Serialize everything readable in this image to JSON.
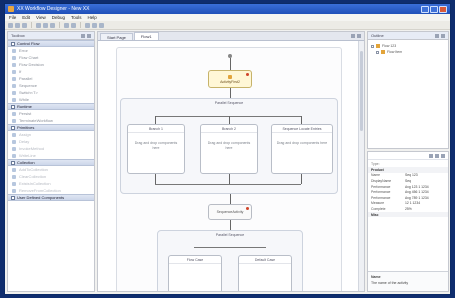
{
  "window": {
    "title": "XX Workflow Designer - New XX"
  },
  "menu": [
    "File",
    "Edit",
    "View",
    "Debug",
    "Tools",
    "Help"
  ],
  "palette": {
    "title": "Toolbox",
    "sections": [
      {
        "label": "Control Flow",
        "items": [
          "Error",
          "Flow Chart",
          "Flow Decision",
          "If",
          "Parallel",
          "Sequence",
          "Switch<T>",
          "While"
        ]
      },
      {
        "label": "Runtime",
        "items": [
          "Persist",
          "TerminateWorkflow"
        ]
      },
      {
        "label": "Primitives",
        "items": [
          "Assign",
          "Delay",
          "InvokeMethod",
          "WriteLine"
        ]
      },
      {
        "label": "Collection",
        "items": [
          "AddToCollection",
          "ClearCollection",
          "ExistsInCollection",
          "RemoveFromCollection"
        ]
      },
      {
        "label": "User Defined Components",
        "items": []
      }
    ]
  },
  "editor": {
    "tabs": [
      "Start Page",
      "Flow1"
    ],
    "active_tab": "Flow1",
    "flow": {
      "top_activity": "ActivityFirst2",
      "sequence_label": "Parallel Sequence",
      "branches": [
        {
          "title": "Branch 1",
          "body": "Drag and drop components here"
        },
        {
          "title": "Branch 2",
          "body": "Drag and drop components here"
        },
        {
          "title": "Sequence Locate Entries",
          "body": "Drag and drop components here"
        }
      ],
      "middle_activity": "SequenceActivity",
      "lower_sequence_label": "Parallel Sequence",
      "lower_branches": [
        "Flow Case",
        "Default Case"
      ]
    }
  },
  "outline": {
    "title": "Outline",
    "items": [
      {
        "label": "Flow 123",
        "level": 0
      },
      {
        "label": "Flow Item",
        "level": 1
      }
    ]
  },
  "properties": {
    "title": "Properties",
    "filter": "Type:",
    "categories": [
      {
        "label": "Product",
        "rows": [
          {
            "key": "Name",
            "value": "Seq 123"
          },
          {
            "key": "DisplayName",
            "value": "Seq"
          },
          {
            "key": "Performance",
            "value": "Avg 123 1 1234"
          },
          {
            "key": "Performance",
            "value": "Avg 456 1 1234"
          },
          {
            "key": "Performance",
            "value": "Avg 789 1 1234"
          },
          {
            "key": "Measure",
            "value": "12 1 1234"
          },
          {
            "key": "Complete",
            "value": "25%"
          }
        ]
      },
      {
        "label": "Misc",
        "rows": []
      }
    ],
    "desc_title": "Name",
    "desc_text": "The name of the activity"
  }
}
